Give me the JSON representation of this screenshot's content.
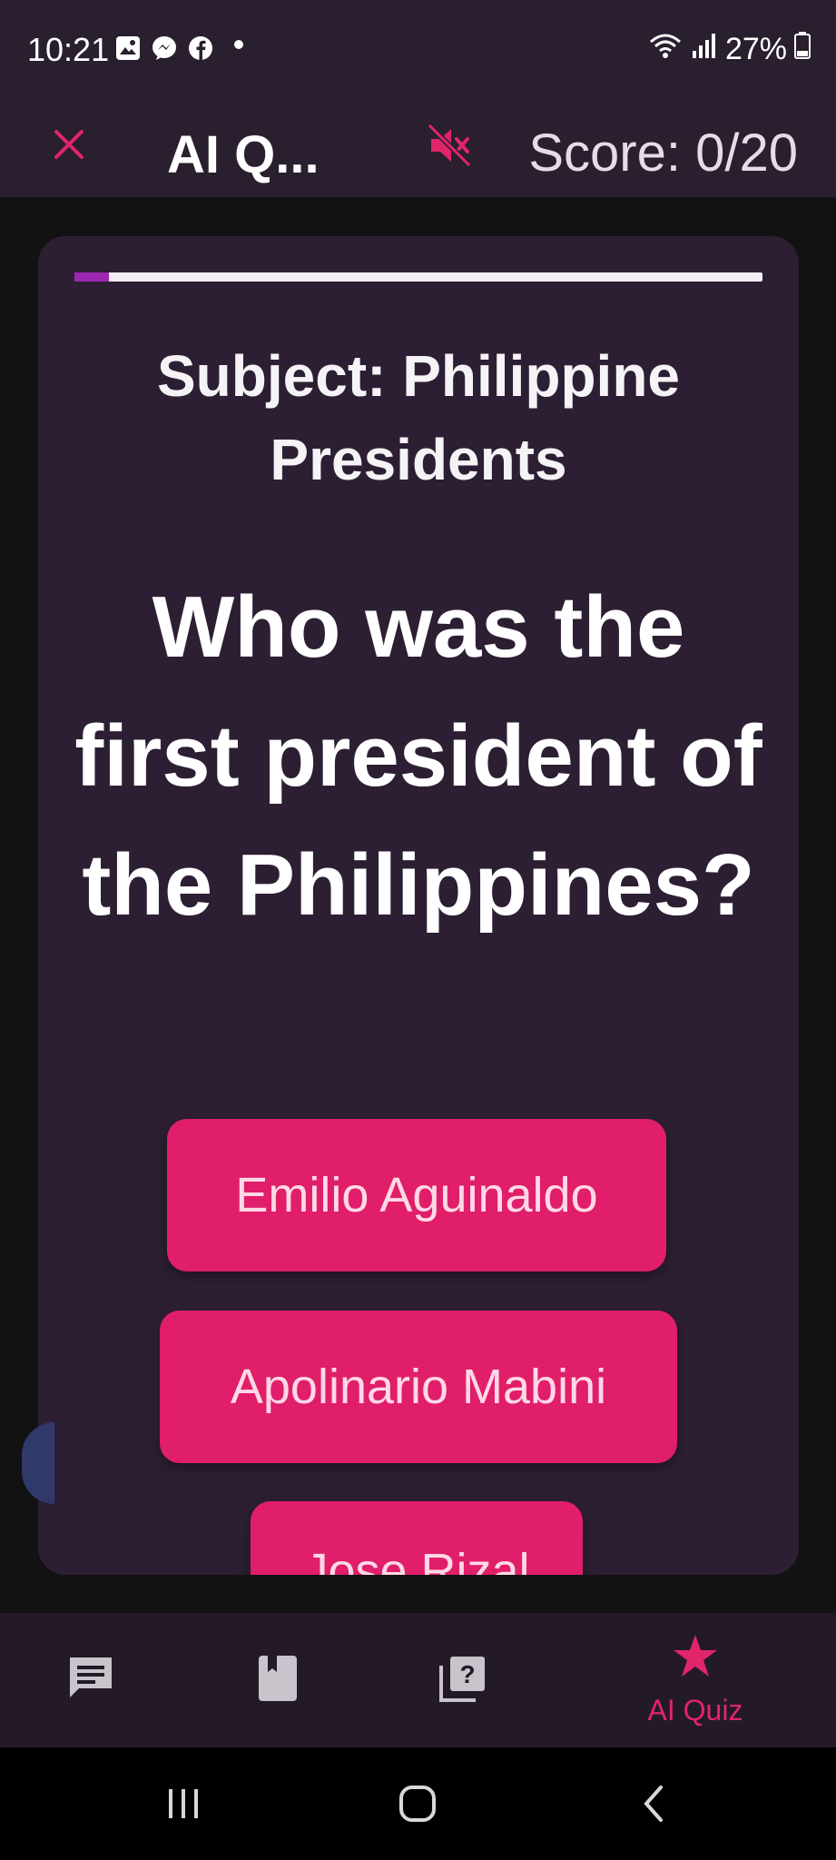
{
  "status_bar": {
    "time": "10:21",
    "battery": "27%",
    "notification_icons": [
      "gallery-icon",
      "messenger-icon",
      "facebook-icon"
    ],
    "right_icons": [
      "wifi-icon",
      "signal-icon",
      "battery-icon"
    ]
  },
  "app_bar": {
    "title": "AI Q...",
    "score": "Score: 0/20",
    "close_icon": "close-icon",
    "mute_icon": "volume-off-icon"
  },
  "quiz": {
    "progress_fraction": 0.05,
    "subject": "Subject: Philippine Presidents",
    "question": "Who was the first president of the Philippines?",
    "answers": [
      "Emilio Aguinaldo",
      "Apolinario Mabini",
      "Jose Rizal"
    ]
  },
  "bottom_nav": {
    "items": [
      {
        "icon": "chat-icon",
        "label": ""
      },
      {
        "icon": "book-icon",
        "label": ""
      },
      {
        "icon": "quiz-icon",
        "label": ""
      },
      {
        "icon": "star-icon",
        "label": "AI Quiz"
      }
    ],
    "accent": "#e0256b"
  },
  "colors": {
    "header_bg": "#2a1f2e",
    "card_bg": "#2d1f33",
    "answer_bg": "#e01e6a",
    "progress": "#9c27b0"
  }
}
